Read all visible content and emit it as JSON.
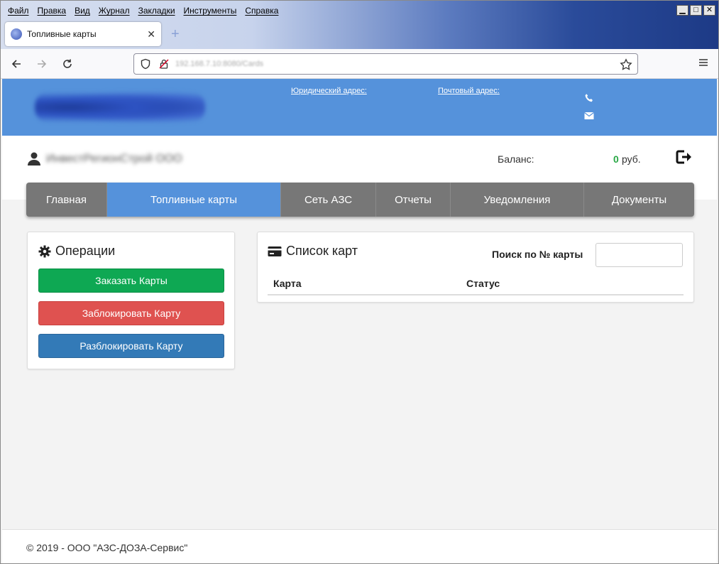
{
  "browser": {
    "menu": [
      "Файл",
      "Правка",
      "Вид",
      "Журнал",
      "Закладки",
      "Инструменты",
      "Справка"
    ],
    "tab_title": "Топливные карты",
    "url": "192.168.7.10:8080/Cards"
  },
  "header": {
    "legal_address": "Юридический адрес:",
    "postal_address": "Почтовый адрес:"
  },
  "user": {
    "name": "ИнвестРегионСтрой ООО",
    "balance_label": "Баланс:",
    "balance_value": "0",
    "balance_unit": "руб."
  },
  "nav": {
    "items": [
      "Главная",
      "Топливные карты",
      "Сеть АЗС",
      "Отчеты",
      "Уведомления",
      "Документы"
    ],
    "active": "Топливные карты"
  },
  "operations": {
    "title": "Операции",
    "order_label": "Заказать Карты",
    "block_label": "Заблокировать Карту",
    "unblock_label": "Разблокировать Карту"
  },
  "cards": {
    "title": "Список карт",
    "search_label": "Поиск по № карты",
    "search_value": "",
    "columns": [
      "Карта",
      "Статус"
    ]
  },
  "footer": {
    "text": "© 2019 - ООО \"АЗС-ДОЗА-Сервис\""
  }
}
